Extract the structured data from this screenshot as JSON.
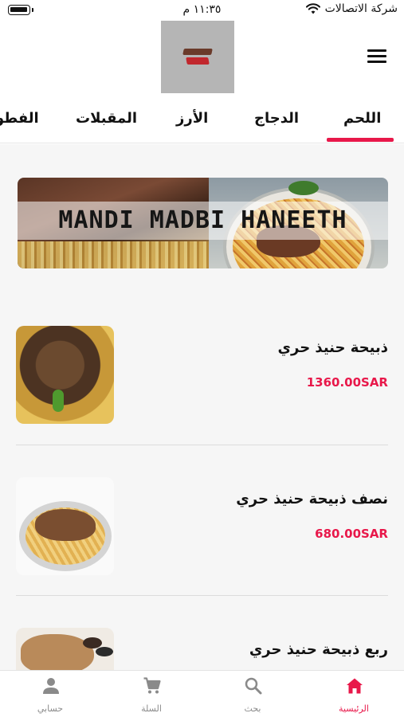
{
  "status_bar": {
    "time": "١١:٣٥ م",
    "carrier": "شركة الاتصالات"
  },
  "header": {
    "menu_icon": "hamburger-menu-icon",
    "logo_icon": "restaurant-logo"
  },
  "tabs": [
    {
      "label": "اللحم",
      "active": true
    },
    {
      "label": "الدجاج",
      "active": false
    },
    {
      "label": "الأرز",
      "active": false
    },
    {
      "label": "المقبلات",
      "active": false
    },
    {
      "label": "الفطو",
      "active": false
    }
  ],
  "banner": {
    "text": "MANDI MADBI HANEETH"
  },
  "products": [
    {
      "name": "ذبيحة حنيذ حري",
      "price": "1360.00SAR"
    },
    {
      "name": "نصف ذبيحة حنيذ حري",
      "price": "680.00SAR"
    },
    {
      "name": "ربع ذبيحة حنيذ حري",
      "price": ""
    }
  ],
  "bottom_nav": [
    {
      "label": "الرئيسية",
      "icon": "home-icon",
      "active": true
    },
    {
      "label": "بحث",
      "icon": "search-icon",
      "active": false
    },
    {
      "label": "السلة",
      "icon": "cart-icon",
      "active": false
    },
    {
      "label": "حسابي",
      "icon": "person-icon",
      "active": false
    }
  ],
  "colors": {
    "accent": "#e8184a",
    "inactive": "#8a8a8a",
    "background": "#f6f6f6"
  }
}
